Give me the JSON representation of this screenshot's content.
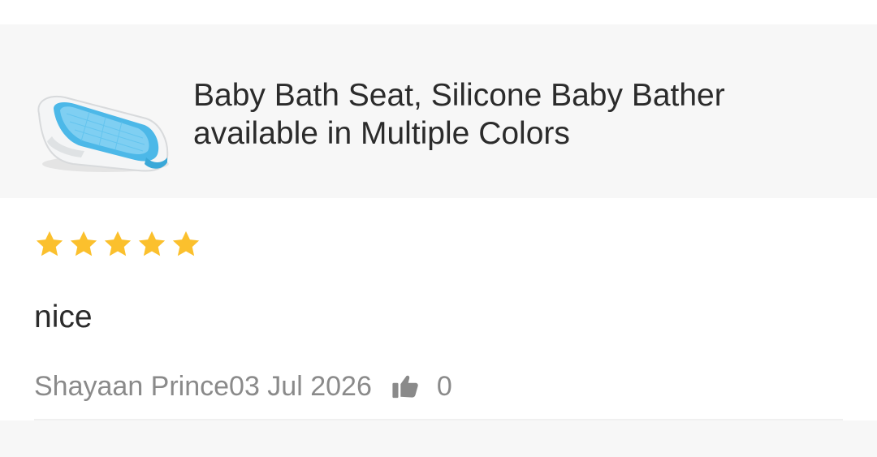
{
  "product": {
    "title_line1": "Baby Bath Seat, Silicone Baby Bather",
    "title_line2": "available in Multiple Colors",
    "image_icon": "baby-bath-seat-image"
  },
  "review": {
    "rating": 5,
    "rating_max": 5,
    "star_color": "#fbc02d",
    "text": "nice",
    "author": "Shayaan Prince",
    "date": "03 Jul 2026",
    "like_icon": "thumbs-up-icon",
    "likes": "0"
  }
}
